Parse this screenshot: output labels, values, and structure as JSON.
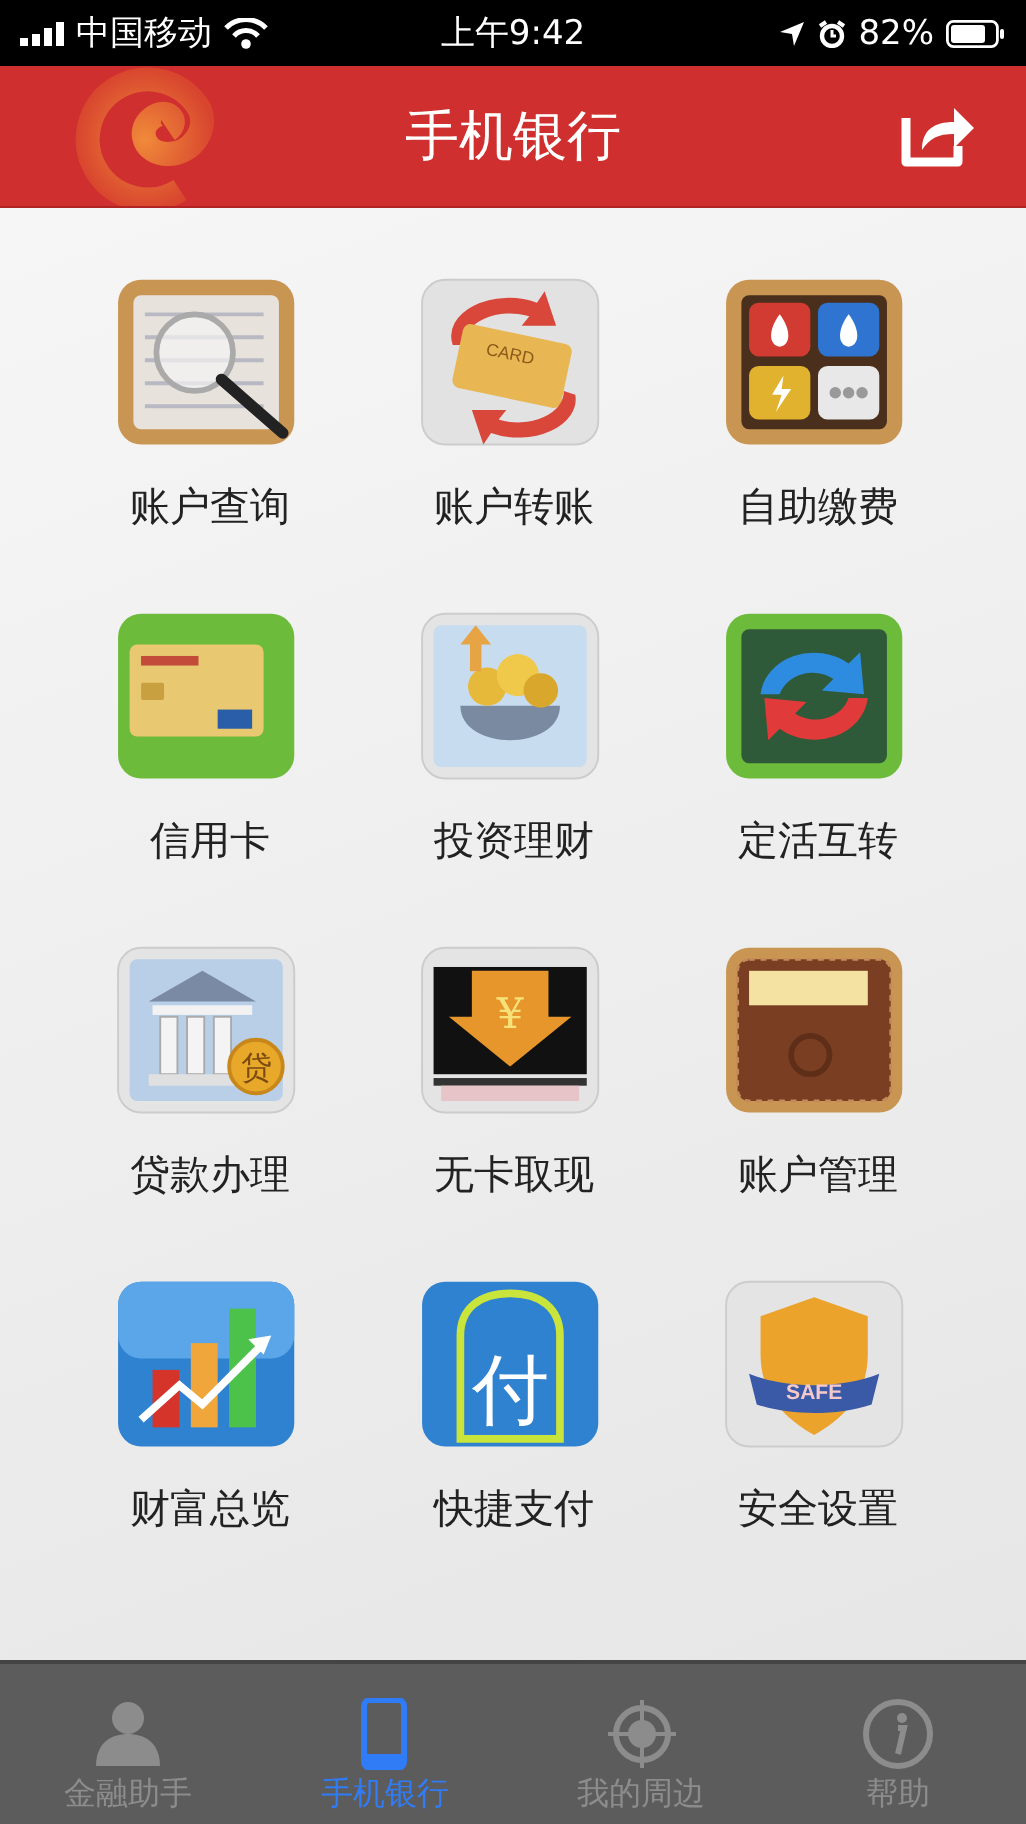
{
  "status_bar": {
    "carrier": "中国移动",
    "time": "上午9:42",
    "battery": "82%"
  },
  "header": {
    "title": "手机银行"
  },
  "tiles": [
    {
      "kind": "magnifier",
      "label": "账户查询"
    },
    {
      "kind": "card-transfer",
      "label": "账户转账",
      "icon_text": "CARD"
    },
    {
      "kind": "utilities",
      "label": "自助缴费"
    },
    {
      "kind": "credit-card",
      "label": "信用卡"
    },
    {
      "kind": "coin-purse",
      "label": "投资理财"
    },
    {
      "kind": "refresh",
      "label": "定活互转"
    },
    {
      "kind": "bank",
      "label": "贷款办理",
      "icon_text": "贷"
    },
    {
      "kind": "cash-out",
      "label": "无卡取现",
      "icon_text": "¥"
    },
    {
      "kind": "wallet",
      "label": "账户管理"
    },
    {
      "kind": "bar-chart",
      "label": "财富总览"
    },
    {
      "kind": "pay",
      "label": "快捷支付",
      "icon_text": "付"
    },
    {
      "kind": "shield",
      "label": "安全设置",
      "icon_text": "SAFE"
    }
  ],
  "tab_bar": [
    {
      "kind": "person",
      "label": "金融助手",
      "selected": false
    },
    {
      "kind": "phone",
      "label": "手机银行",
      "selected": true
    },
    {
      "kind": "target",
      "label": "我的周边",
      "selected": false
    },
    {
      "kind": "info",
      "label": "帮助",
      "selected": false
    }
  ]
}
